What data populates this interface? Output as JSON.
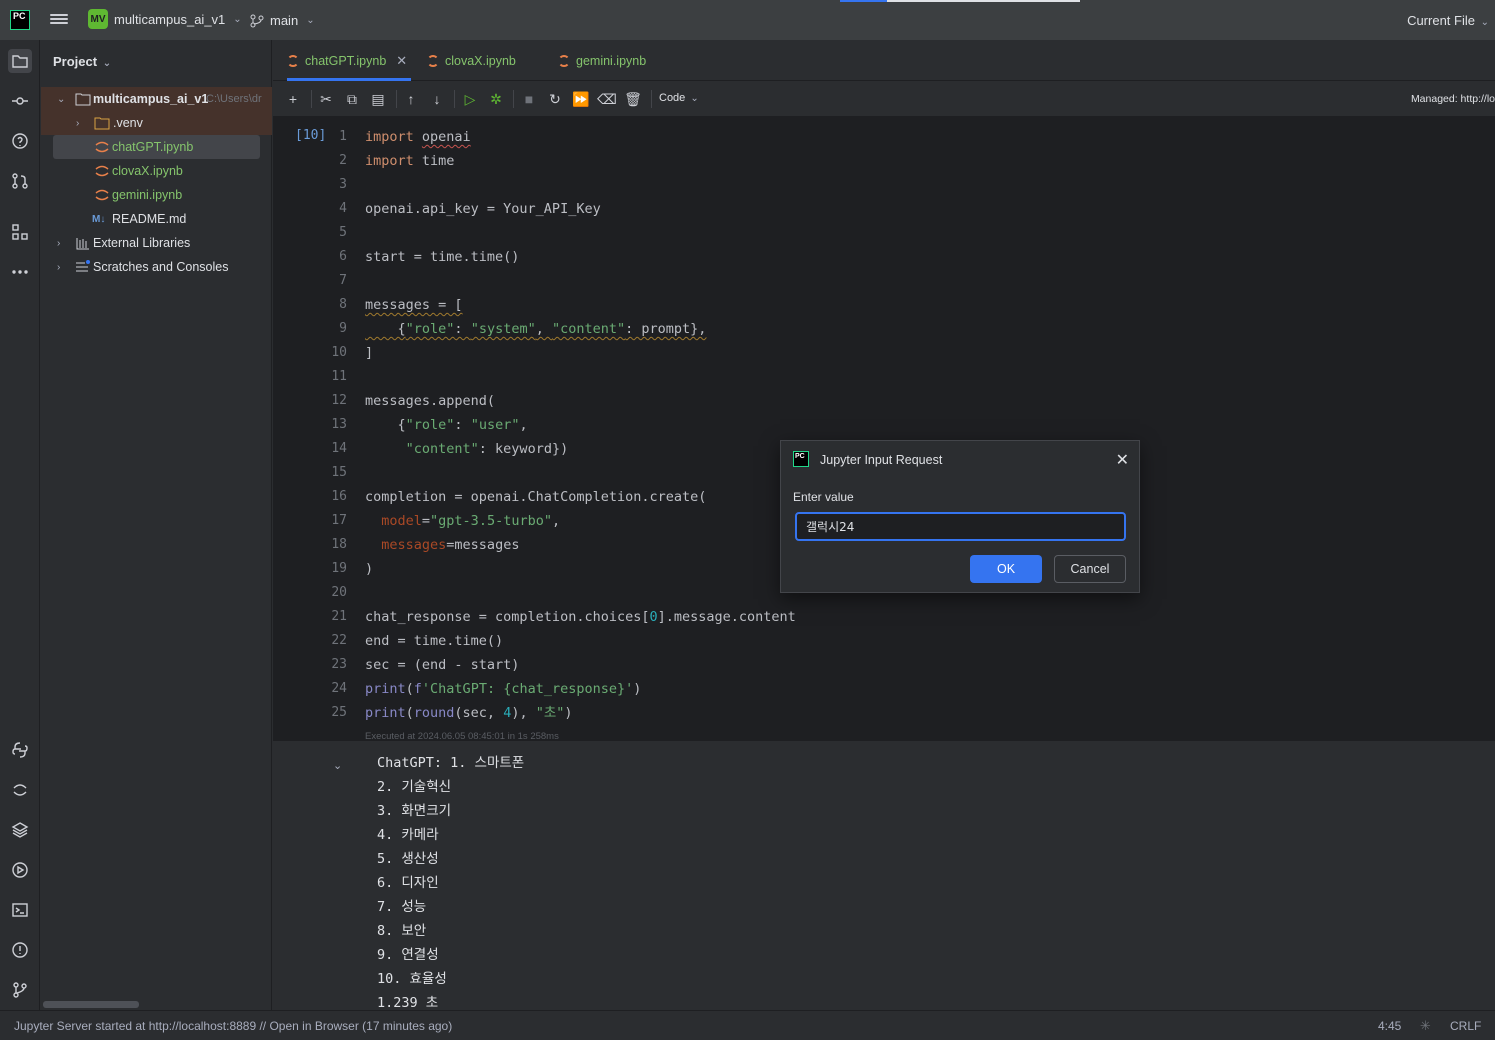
{
  "titlebar": {
    "logo_text": "PC",
    "project_badge": "MV",
    "project_name": "multicampus_ai_v1",
    "branch": "main",
    "run_config": "Current File"
  },
  "left_strip": {
    "icons": [
      "folder-icon",
      "commit-icon",
      "learn-icon",
      "pull-requests-icon",
      "structure-icon",
      "more-icon",
      "python-console-icon",
      "jupyter-icon",
      "layers-icon",
      "services-icon",
      "terminal-icon",
      "problems-icon",
      "git-icon"
    ]
  },
  "project_panel": {
    "title": "Project",
    "root_name": "multicampus_ai_v1",
    "root_path": "C:\\Users\\dr",
    "items": [
      {
        "label": ".venv",
        "type": "folder"
      },
      {
        "label": "chatGPT.ipynb",
        "type": "notebook"
      },
      {
        "label": "clovaX.ipynb",
        "type": "notebook"
      },
      {
        "label": "gemini.ipynb",
        "type": "notebook"
      },
      {
        "label": "README.md",
        "type": "markdown"
      },
      {
        "label": "External Libraries",
        "type": "libraries"
      },
      {
        "label": "Scratches and Consoles",
        "type": "scratches"
      }
    ],
    "md_badge": "M↓"
  },
  "tabs": [
    {
      "label": "chatGPT.ipynb",
      "active": true
    },
    {
      "label": "clovaX.ipynb",
      "active": false
    },
    {
      "label": "gemini.ipynb",
      "active": false
    }
  ],
  "toolbar": {
    "cell_type": "Code",
    "managed": "Managed: http://lo"
  },
  "cell": {
    "exec_count": "[10]",
    "line_numbers": [
      "1",
      "2",
      "3",
      "4",
      "5",
      "6",
      "7",
      "8",
      "9",
      "10",
      "11",
      "12",
      "13",
      "14",
      "15",
      "16",
      "17",
      "18",
      "19",
      "20",
      "21",
      "22",
      "23",
      "24",
      "25"
    ],
    "lines": [
      "import openai",
      "import time",
      "",
      "openai.api_key = Your_API_Key",
      "",
      "start = time.time()",
      "",
      "messages = [",
      "    {\"role\": \"system\", \"content\": prompt},",
      "]",
      "",
      "messages.append(",
      "    {\"role\": \"user\",",
      "     \"content\": keyword})",
      "",
      "completion = openai.ChatCompletion.create(",
      "  model=\"gpt-3.5-turbo\",",
      "  messages=messages",
      ")",
      "",
      "chat_response = completion.choices[0].message.content",
      "end = time.time()",
      "sec = (end - start)",
      "print(f'ChatGPT: {chat_response}')",
      "print(round(sec, 4), \"초\")"
    ],
    "exec_info": "Executed at 2024.06.05 08:45:01 in 1s 258ms"
  },
  "output": {
    "lines": [
      "ChatGPT: 1. 스마트폰",
      "2. 기술혁신",
      "3. 화면크기",
      "4. 카메라",
      "5. 생산성",
      "6. 디자인",
      "7. 성능",
      "8. 보안",
      "9. 연결성",
      "10. 효율성",
      "1.239 초"
    ]
  },
  "dialog": {
    "icon_text": "PC",
    "title": "Jupyter Input Request",
    "label": "Enter value",
    "value": "갤럭시24",
    "ok": "OK",
    "cancel": "Cancel"
  },
  "statusbar": {
    "message": "Jupyter Server started at http://localhost:8889 // Open in Browser (17 minutes ago)",
    "position": "4:45",
    "line_ending": "CRLF"
  },
  "colors": {
    "accent": "#3574f0",
    "notebook_green": "#85c46c",
    "keyword": "#cf8e6d",
    "string": "#6aab73"
  }
}
